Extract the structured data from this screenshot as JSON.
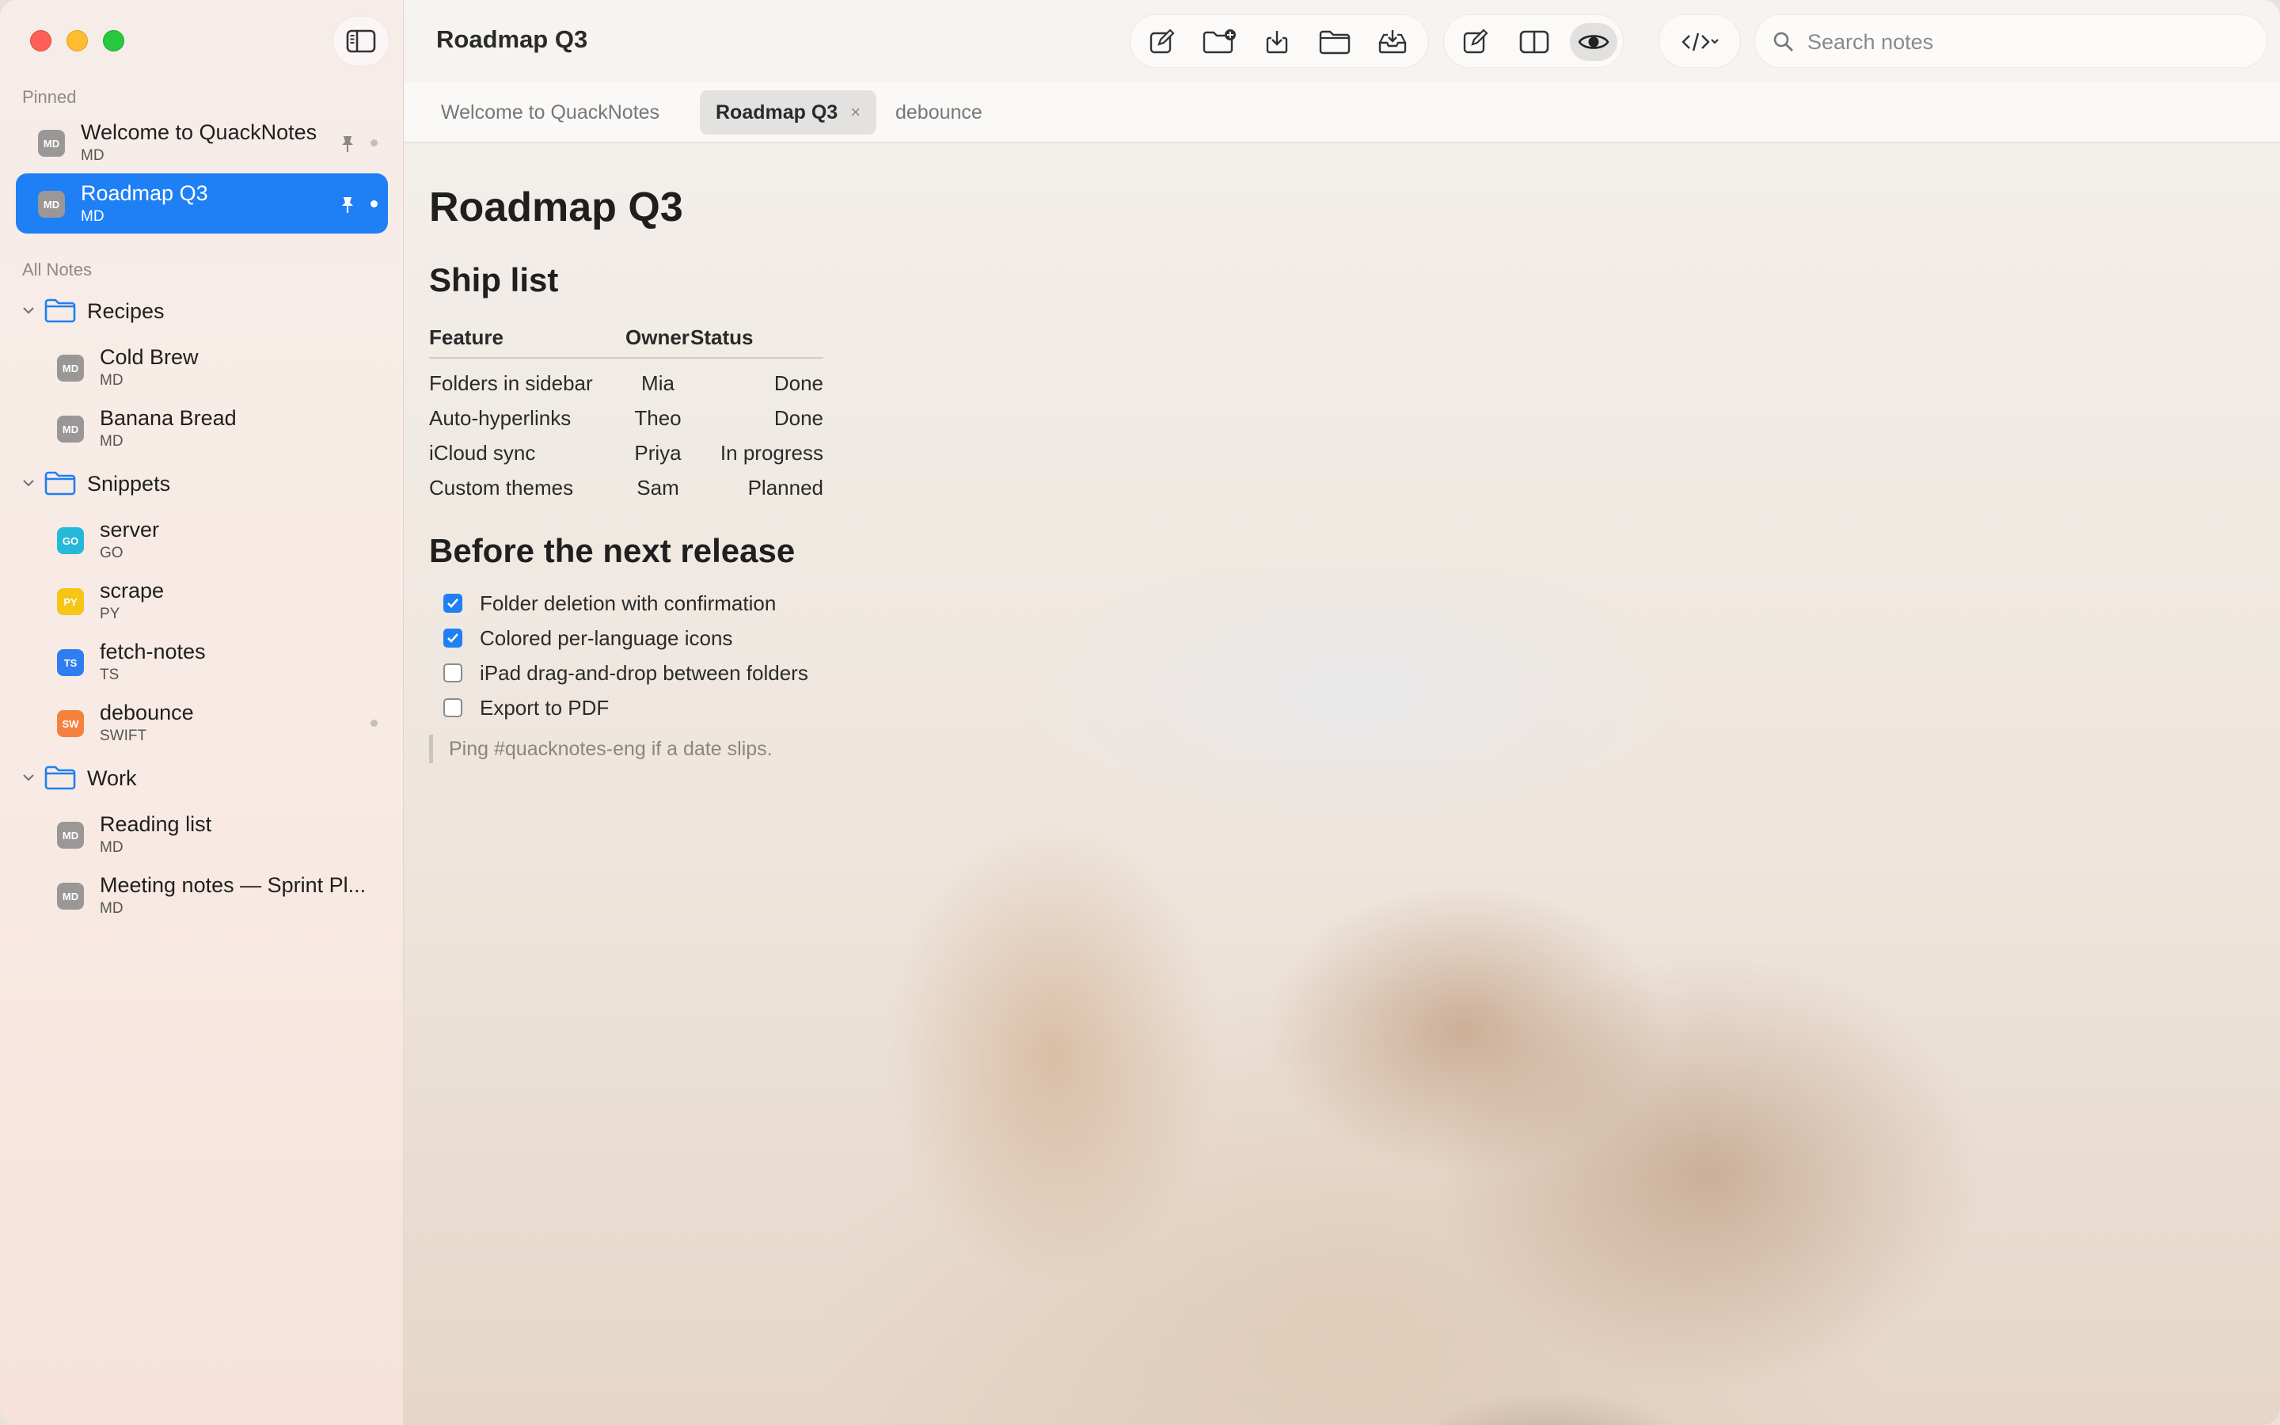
{
  "window": {
    "title": "Roadmap Q3"
  },
  "sidebar": {
    "pinned_label": "Pinned",
    "all_notes_label": "All Notes",
    "pinned": [
      {
        "title": "Welcome to QuackNotes",
        "type": "MD",
        "badge": "MD",
        "badge_color": "#9a9796"
      },
      {
        "title": "Roadmap Q3",
        "type": "MD",
        "badge": "MD",
        "badge_color": "#9a9796"
      }
    ],
    "folders": [
      {
        "name": "Recipes",
        "notes": [
          {
            "title": "Cold Brew",
            "type": "MD",
            "badge": "MD",
            "badge_color": "#9a9796"
          },
          {
            "title": "Banana Bread",
            "type": "MD",
            "badge": "MD",
            "badge_color": "#9a9796"
          }
        ]
      },
      {
        "name": "Snippets",
        "notes": [
          {
            "title": "server",
            "type": "GO",
            "badge": "GO",
            "badge_color": "#26b8d8"
          },
          {
            "title": "scrape",
            "type": "PY",
            "badge": "PY",
            "badge_color": "#f5c518"
          },
          {
            "title": "fetch-notes",
            "type": "TS",
            "badge": "TS",
            "badge_color": "#2f7df0"
          },
          {
            "title": "debounce",
            "type": "SWIFT",
            "badge": "SW",
            "badge_color": "#f5813f"
          }
        ]
      },
      {
        "name": "Work",
        "notes": [
          {
            "title": "Reading list",
            "type": "MD",
            "badge": "MD",
            "badge_color": "#9a9796"
          },
          {
            "title": "Meeting notes — Sprint Pl...",
            "type": "MD",
            "badge": "MD",
            "badge_color": "#9a9796"
          }
        ]
      }
    ]
  },
  "search": {
    "placeholder": "Search notes"
  },
  "tabs": [
    {
      "label": "Welcome to QuackNotes"
    },
    {
      "label": "Roadmap Q3",
      "close": "×"
    },
    {
      "label": "debounce"
    }
  ],
  "doc": {
    "h1": "Roadmap Q3",
    "h2_ship": "Ship list",
    "table": {
      "headers": [
        "Feature",
        "Owner",
        "Status"
      ],
      "rows": [
        [
          "Folders in sidebar",
          "Mia",
          "Done"
        ],
        [
          "Auto-hyperlinks",
          "Theo",
          "Done"
        ],
        [
          "iCloud sync",
          "Priya",
          "In progress"
        ],
        [
          "Custom themes",
          "Sam",
          "Planned"
        ]
      ]
    },
    "h2_release": "Before the next release",
    "todos": [
      {
        "text": "Folder deletion with confirmation",
        "checked": true
      },
      {
        "text": "Colored per-language icons",
        "checked": true
      },
      {
        "text": "iPad drag-and-drop between folders",
        "checked": false
      },
      {
        "text": "Export to PDF",
        "checked": false
      }
    ],
    "quote": "Ping #quacknotes-eng if a date slips."
  },
  "colors": {
    "accent": "#1f7ff5"
  }
}
